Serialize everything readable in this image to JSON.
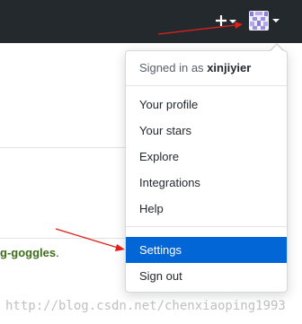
{
  "header": {
    "new_icon": "plus-icon",
    "new_caret_icon": "caret-down-icon",
    "avatar_icon": "avatar-identicon",
    "avatar_caret_icon": "caret-down-icon"
  },
  "page": {
    "repo_link_text": "g-goggles",
    "repo_suffix": "."
  },
  "dropdown": {
    "signed_in_prefix": "Signed in as",
    "username": "xinjiyier",
    "items": [
      {
        "label": "Your profile"
      },
      {
        "label": "Your stars"
      },
      {
        "label": "Explore"
      },
      {
        "label": "Integrations"
      },
      {
        "label": "Help"
      },
      {
        "label": "Settings",
        "active": true
      },
      {
        "label": "Sign out"
      }
    ]
  },
  "watermark": "http://blog.csdn.net/chenxiaoping1993",
  "colors": {
    "header_bg": "#24292e",
    "active_item_bg": "#0366d6",
    "annotation_arrow": "#e0201a",
    "repo_link": "#3c6e1a"
  }
}
